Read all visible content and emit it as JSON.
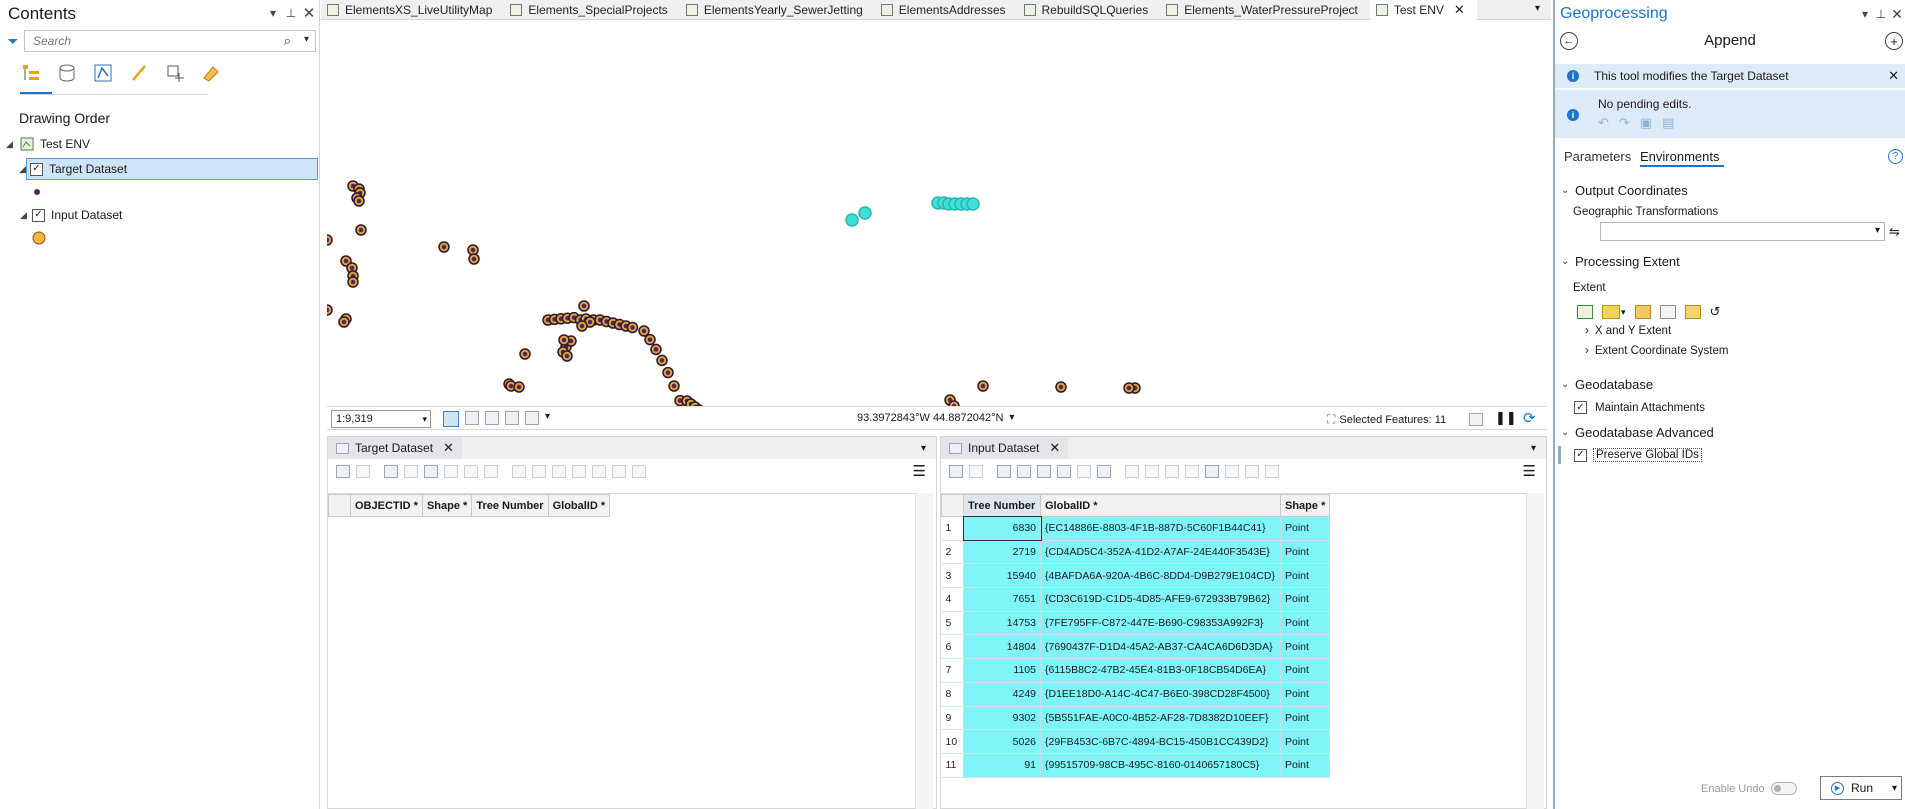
{
  "contents": {
    "title": "Contents",
    "search_placeholder": "Search",
    "drawing_order_label": "Drawing Order",
    "map_name": "Test ENV",
    "layers": [
      {
        "name": "Target Dataset",
        "checked": true,
        "selected": true
      },
      {
        "name": "Input Dataset",
        "checked": true,
        "selected": false
      }
    ]
  },
  "tabs": [
    {
      "label": "ElementsXS_LiveUtilityMap",
      "active": false
    },
    {
      "label": "Elements_SpecialProjects",
      "active": false
    },
    {
      "label": "ElementsYearly_SewerJetting",
      "active": false
    },
    {
      "label": "ElementsAddresses",
      "active": false
    },
    {
      "label": "RebuildSQLQueries",
      "active": false
    },
    {
      "label": "Elements_WaterPressureProject",
      "active": false
    },
    {
      "label": "Test ENV",
      "active": true
    }
  ],
  "map_status": {
    "scale": "1:9,319",
    "coordinates": "93.3972843°W 44.8872042°N",
    "selected_features": "Selected Features: 11"
  },
  "target_table": {
    "tab_label": "Target Dataset",
    "columns": [
      "OBJECTID *",
      "Shape *",
      "Tree Number",
      "GlobalID *"
    ]
  },
  "input_table": {
    "tab_label": "Input Dataset",
    "columns": [
      "Tree Number",
      "GlobalID *",
      "Shape *"
    ],
    "rows": [
      {
        "n": "1",
        "tree": "6830",
        "gid": "{EC14886E-8803-4F1B-887D-5C60F1B44C41}",
        "shape": "Point"
      },
      {
        "n": "2",
        "tree": "2719",
        "gid": "{CD4AD5C4-352A-41D2-A7AF-24E440F3543E}",
        "shape": "Point"
      },
      {
        "n": "3",
        "tree": "15940",
        "gid": "{4BAFDA6A-920A-4B6C-8DD4-D9B279E104CD}",
        "shape": "Point"
      },
      {
        "n": "4",
        "tree": "7651",
        "gid": "{CD3C619D-C1D5-4D85-AFE9-672933B79B62}",
        "shape": "Point"
      },
      {
        "n": "5",
        "tree": "14753",
        "gid": "{7FE795FF-C872-447E-B690-C98353A992F3}",
        "shape": "Point"
      },
      {
        "n": "6",
        "tree": "14804",
        "gid": "{7690437F-D1D4-45A2-AB37-CA4CA6D6D3DA}",
        "shape": "Point"
      },
      {
        "n": "7",
        "tree": "1105",
        "gid": "{6115B8C2-47B2-45E4-81B3-0F18CB54D6EA}",
        "shape": "Point"
      },
      {
        "n": "8",
        "tree": "4249",
        "gid": "{D1EE18D0-A14C-4C47-B6E0-398CD28F4500}",
        "shape": "Point"
      },
      {
        "n": "9",
        "tree": "9302",
        "gid": "{5B551FAE-A0C0-4B52-AF28-7D8382D10EEF}",
        "shape": "Point"
      },
      {
        "n": "10",
        "tree": "5026",
        "gid": "{29FB453C-6B7C-4894-BC15-450B1CC439D2}",
        "shape": "Point"
      },
      {
        "n": "11",
        "tree": "91",
        "gid": "{99515709-98CB-495C-8160-0140657180C5}",
        "shape": "Point"
      }
    ]
  },
  "geoprocessing": {
    "title": "Geoprocessing",
    "tool_name": "Append",
    "info_message": "This tool modifies the Target Dataset",
    "pending_edits": "No pending edits.",
    "tab_parameters": "Parameters",
    "tab_environments": "Environments",
    "sections": {
      "output_coordinates": "Output Coordinates",
      "geographic_transformations": "Geographic Transformations",
      "processing_extent": "Processing Extent",
      "extent": "Extent",
      "xy_extent": "X and Y Extent",
      "extent_cs": "Extent Coordinate System",
      "geodatabase": "Geodatabase",
      "maintain_attachments": "Maintain Attachments",
      "geodatabase_advanced": "Geodatabase Advanced",
      "preserve_global_ids": "Preserve Global IDs"
    },
    "enable_undo": "Enable Undo",
    "run": "Run"
  },
  "colors": {
    "accent": "#1a74c7",
    "info_band": "#dcebf7",
    "selection": "#7ff5fa",
    "layer_highlight": "#cde3f7",
    "target_point": "#d8a63a",
    "input_point": "#f5b942",
    "selected_point": "#3fe0d8"
  }
}
